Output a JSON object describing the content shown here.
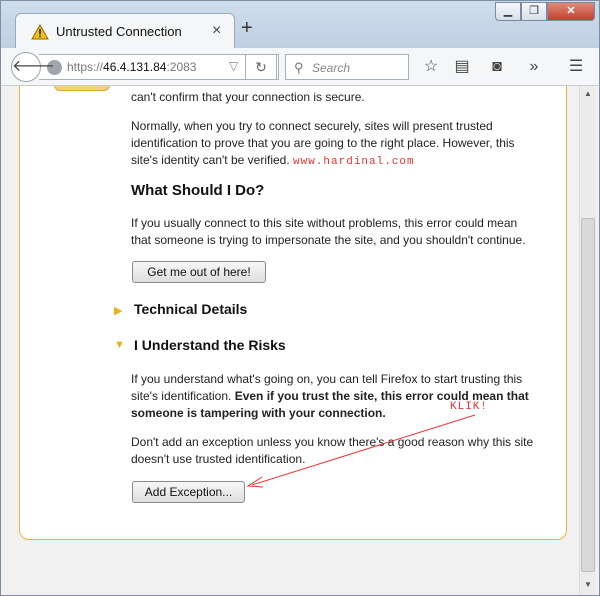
{
  "window": {
    "tab_title": "Untrusted Connection",
    "tab_close": "×",
    "new_tab": "+",
    "controls": {
      "minimize": "▁",
      "maximize": "❐",
      "close": "✕"
    }
  },
  "navbar": {
    "url_scheme": "https://",
    "url_host": "46.4.131.84",
    "url_port": ":2083",
    "search_placeholder": "Search",
    "icons": [
      "back-arrow-icon",
      "globe-icon",
      "reload-icon",
      "search-icon",
      "bookmark-star-icon",
      "reading-list-icon",
      "pocket-icon",
      "overflow-chevron-icon",
      "menu-icon"
    ]
  },
  "page": {
    "intro_tail": "can't confirm that your connection is secure.",
    "normally_text": "Normally, when you try to connect securely, sites will present trusted identification to prove that you are going to the right place. However, this site's identity can't be verified.",
    "watermark": "www.hardinal.com",
    "what_heading": "What Should I Do?",
    "what_text": "If you usually connect to this site without problems, this error could mean that someone is trying to impersonate the site, and you shouldn't continue.",
    "get_out_button": "Get me out of here!",
    "technical_details": "Technical Details",
    "understand_risks": "I Understand the Risks",
    "risks_text_plain": "If you understand what's going on, you can tell Firefox to start trusting this site's identification.",
    "risks_text_bold": "Even if you trust the site, this error could mean that someone is tampering with your connection.",
    "exception_text": "Don't add an exception unless you know there's a good reason why this site doesn't use trusted identification.",
    "add_exception_button": "Add Exception...",
    "annotation": "KLIK!"
  },
  "colors": {
    "accent_border": "#e6b73f",
    "triangle": "#e8b20f",
    "annotation_red": "#e33"
  }
}
